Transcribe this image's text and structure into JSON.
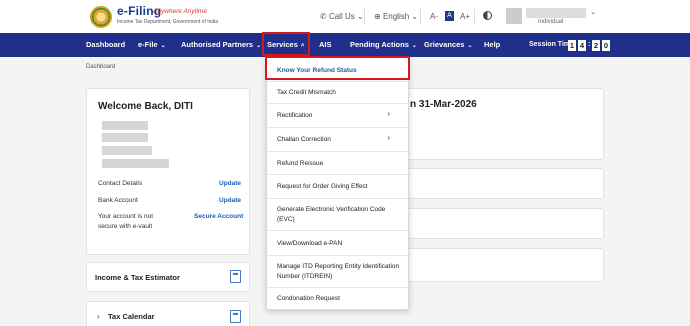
{
  "header": {
    "logo_title": "e-Filing",
    "logo_tagline": "Anywhere Anytime",
    "logo_subtitle": "Income Tax Department, Government of India",
    "call_us": "Call Us",
    "language": "English",
    "font_small": "A-",
    "font_normal": "A",
    "font_large": "A+",
    "user_role": "Individual"
  },
  "nav": {
    "items": [
      {
        "label": "Dashboard"
      },
      {
        "label": "e-File"
      },
      {
        "label": "Authorised Partners"
      },
      {
        "label": "Services"
      },
      {
        "label": "AIS"
      },
      {
        "label": "Pending Actions"
      },
      {
        "label": "Grievances"
      },
      {
        "label": "Help"
      }
    ],
    "session_label": "Session Time",
    "session_digits": [
      "1",
      "4",
      "2",
      "0"
    ]
  },
  "breadcrumb": "Dashboard",
  "welcome": {
    "title": "Welcome Back, DITI",
    "contact_label": "Contact Details",
    "contact_action": "Update",
    "bank_label": "Bank Account",
    "bank_action": "Update",
    "account_label_1": "Your account is not",
    "account_label_2": "secure with e-vault",
    "account_action": "Secure Account"
  },
  "tax_estimator": "Income & Tax Estimator",
  "tax_calendar": "Tax Calendar",
  "due_text": "n 31-Mar-2026",
  "services_dropdown": [
    {
      "label": "Know Your Refund Status",
      "highlight": true
    },
    {
      "label": "Tax Credit Mismatch"
    },
    {
      "label": "Rectification",
      "submenu": true
    },
    {
      "label": "Challan Correction",
      "submenu": true
    },
    {
      "label": "Refund Reissue"
    },
    {
      "label": "Request for Order Giving Effect"
    },
    {
      "label_1": "Generate Electronic Verification Code",
      "label_2": "(EVC)"
    },
    {
      "label": "View/Download e-PAN"
    },
    {
      "label_1": "Manage ITD Reporting Entity Identification",
      "label_2": "Number (ITDREIN)"
    },
    {
      "label": "Condonation Request"
    }
  ],
  "colors": {
    "nav_bg": "#1f2f8a",
    "link_blue": "#1a5fb4",
    "highlight_red": "#d8171f"
  }
}
